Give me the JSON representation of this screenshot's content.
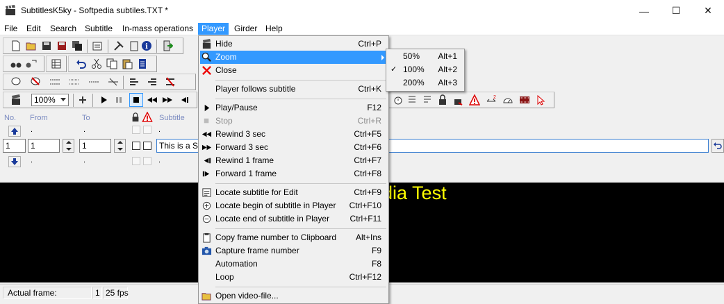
{
  "window": {
    "title": "SubtitlesK5ky - Softpedia subtiles.TXT *",
    "minimize": "—",
    "maximize": "☐",
    "close": "✕"
  },
  "menubar": [
    "File",
    "Edit",
    "Search",
    "Subtitle",
    "In-mass operations",
    "Player",
    "Girder",
    "Help"
  ],
  "toolbar": {
    "zoom_value": "100%"
  },
  "editor": {
    "col_no": "No.",
    "col_from": "From",
    "col_to": "To",
    "col_subtitle": "Subtitle",
    "row_prev": {
      "dot": "."
    },
    "current": {
      "no": "1",
      "from": "1",
      "to": "1",
      "text": "This is a Sof"
    },
    "row_next": {
      "dot": "."
    }
  },
  "video": {
    "subtitle_text": "edia Test"
  },
  "status": {
    "label": "Actual frame:",
    "frame": "1",
    "fps": "25 fps"
  },
  "player_menu": [
    {
      "label": "Hide",
      "shortcut": "Ctrl+P",
      "icon": "clapper-icon"
    },
    {
      "label": "Zoom",
      "shortcut": "",
      "icon": "magnifier-icon",
      "highlighted": true,
      "submenu": true
    },
    {
      "label": "Close",
      "shortcut": "",
      "icon": "red-x-icon"
    },
    {
      "label": "Player follows subtitle",
      "shortcut": "Ctrl+K"
    },
    {
      "label": "Play/Pause",
      "shortcut": "F12",
      "icon": "play-icon"
    },
    {
      "label": "Stop",
      "shortcut": "Ctrl+R",
      "icon": "stop-icon",
      "disabled": true
    },
    {
      "label": "Rewind 3 sec",
      "shortcut": "Ctrl+F5",
      "icon": "rewind-icon"
    },
    {
      "label": "Forward 3 sec",
      "shortcut": "Ctrl+F6",
      "icon": "forward-icon"
    },
    {
      "label": "Rewind 1 frame",
      "shortcut": "Ctrl+F7",
      "icon": "rewind-frame-icon"
    },
    {
      "label": "Forward 1 frame",
      "shortcut": "Ctrl+F8",
      "icon": "forward-frame-icon"
    },
    {
      "label": "Locate subtitle for Edit",
      "shortcut": "Ctrl+F9",
      "icon": "locate-icon"
    },
    {
      "label": "Locate begin of subtitle in Player",
      "shortcut": "Ctrl+F10",
      "icon": "locate-begin-icon"
    },
    {
      "label": "Locate end of subtitle in Player",
      "shortcut": "Ctrl+F11",
      "icon": "locate-end-icon"
    },
    {
      "label": "Copy frame number to Clipboard",
      "shortcut": "Alt+Ins",
      "icon": "clipboard-icon"
    },
    {
      "label": "Capture frame number",
      "shortcut": "F9",
      "icon": "camera-icon"
    },
    {
      "label": "Automation",
      "shortcut": "F8"
    },
    {
      "label": "Loop",
      "shortcut": "Ctrl+F12"
    },
    {
      "label": "Open video-file...",
      "shortcut": "",
      "icon": "open-folder-icon"
    }
  ],
  "zoom_menu": [
    {
      "label": "50%",
      "shortcut": "Alt+1",
      "checked": false
    },
    {
      "label": "100%",
      "shortcut": "Alt+2",
      "checked": true
    },
    {
      "label": "200%",
      "shortcut": "Alt+3",
      "checked": false
    }
  ],
  "colors": {
    "highlight": "#3399ff",
    "video_bg": "#000000",
    "subtitle_fg": "#ffff00"
  }
}
